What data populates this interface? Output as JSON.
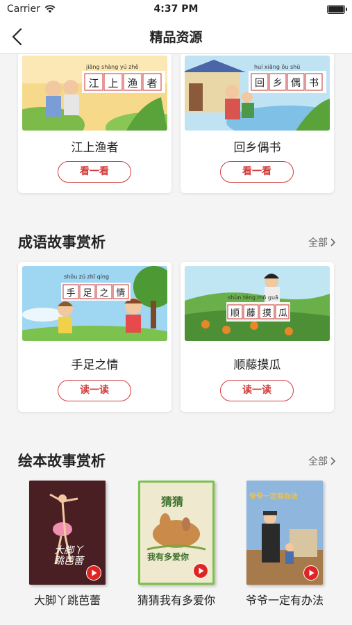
{
  "status_bar": {
    "carrier": "Carrier",
    "time": "4:37 PM"
  },
  "nav": {
    "title": "精品资源"
  },
  "top_cards": [
    {
      "name": "江上渔者",
      "button": "看一看",
      "pinyin": "jiāng shàng yú zhě",
      "chars": [
        "江",
        "上",
        "渔",
        "者"
      ]
    },
    {
      "name": "回乡偶书",
      "button": "看一看",
      "pinyin": "huí xiāng ǒu shū",
      "chars": [
        "回",
        "乡",
        "偶",
        "书"
      ]
    }
  ],
  "idiom_section": {
    "title": "成语故事赏析",
    "more": "全部",
    "cards": [
      {
        "name": "手足之情",
        "button": "读一读",
        "pinyin": "shǒu zú zhī qíng",
        "chars": [
          "手",
          "足",
          "之",
          "情"
        ]
      },
      {
        "name": "顺藤摸瓜",
        "button": "读一读",
        "pinyin": "shùn téng mō guā",
        "chars": [
          "顺",
          "藤",
          "摸",
          "瓜"
        ]
      }
    ]
  },
  "picture_book_section": {
    "title": "绘本故事赏析",
    "more": "全部",
    "books": [
      {
        "name": "大脚丫跳芭蕾",
        "cover_text": "大脚丫\n跳芭蕾",
        "color": "#5a2a2e"
      },
      {
        "name": "猜猜我有多爱你",
        "cover_title": "猜猜",
        "cover_sub": "我有多爱你",
        "color": "#e8e4c9"
      },
      {
        "name": "爷爷一定有办法",
        "cover_title": "爷爷一定有办法",
        "color": "#6f9ccf"
      }
    ]
  },
  "colors": {
    "accent": "#d23a3a",
    "background": "#f4f4f4"
  }
}
